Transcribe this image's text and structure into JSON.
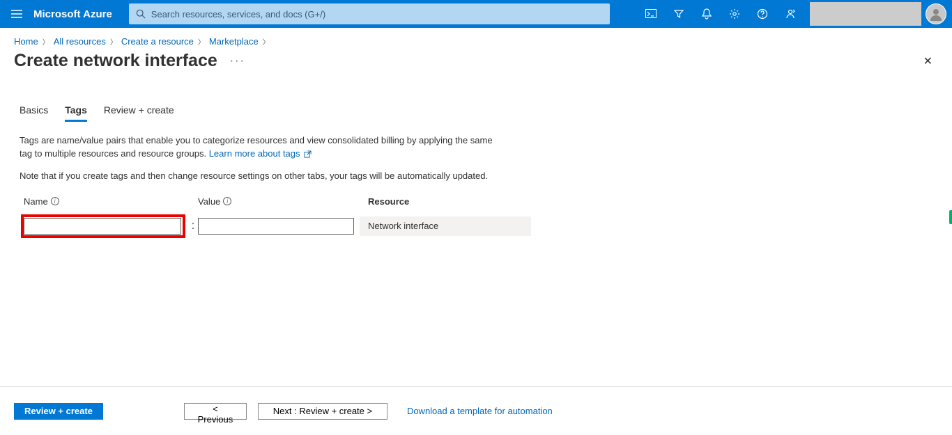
{
  "header": {
    "brand": "Microsoft Azure",
    "search_placeholder": "Search resources, services, and docs (G+/)"
  },
  "breadcrumb": {
    "items": [
      "Home",
      "All resources",
      "Create a resource",
      "Marketplace"
    ]
  },
  "page": {
    "title": "Create network interface"
  },
  "tabs": {
    "items": [
      "Basics",
      "Tags",
      "Review + create"
    ],
    "active_index": 1
  },
  "content": {
    "desc_text": "Tags are name/value pairs that enable you to categorize resources and view consolidated billing by applying the same tag to multiple resources and resource groups. ",
    "desc_link": "Learn more about tags",
    "note_text": "Note that if you create tags and then change resource settings on other tabs, your tags will be automatically updated."
  },
  "tags_table": {
    "headers": {
      "name": "Name",
      "value": "Value",
      "resource": "Resource"
    },
    "rows": [
      {
        "name": "",
        "value": "",
        "resource": "Network interface"
      }
    ]
  },
  "footer": {
    "review_label": "Review + create",
    "prev_label": "< Previous",
    "next_label": "Next : Review + create >",
    "download_label": "Download a template for automation"
  }
}
